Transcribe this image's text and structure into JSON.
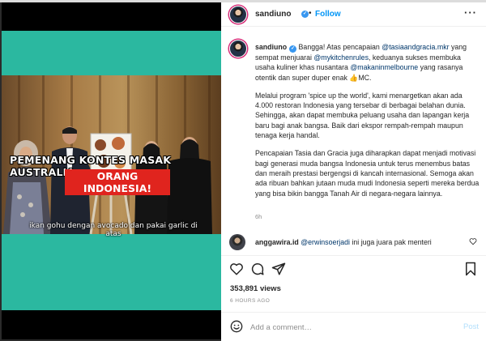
{
  "media": {
    "headline_line1": "PEMENANG KONTES MASAK AUSTRALIA,",
    "headline_line2": "ORANG INDONESIA!",
    "subtitle": "ikan gohu dengan avocado dan pakai garlic di atas",
    "teal_color": "#2bb8a0",
    "headline_bg_color": "#e0241e"
  },
  "header": {
    "username": "sandiuno",
    "verified_icon": "verified-badge-icon",
    "separator": "•",
    "follow_label": "Follow",
    "more_icon": "more-options-icon",
    "more_glyph": "···"
  },
  "caption": {
    "username": "sandiuno",
    "p1_part1": " Bangga! Atas pencapaian ",
    "mention1": "@tasiaandgracia.mkr",
    "p1_part2": " yang sempat menjuarai ",
    "mention2": "@mykitchenrules",
    "p1_part3": ", keduanya sukses membuka usaha kuliner khas nusantara ",
    "mention3": "@makaninmelbourne",
    "p1_part4": " yang rasanya otentik dan super duper enak 👍MC.",
    "p2": "Melalui program 'spice up the world', kami menargetkan akan ada 4.000 restoran Indonesia yang tersebar di berbagai belahan dunia. Sehingga, akan dapat membuka peluang usaha dan lapangan kerja baru bagi anak bangsa. Baik dari ekspor rempah-rempah maupun tenaga kerja handal.",
    "p3": "Pencapaian Tasia dan Gracia juga diharapkan dapat menjadi motivasi bagi generasi muda bangsa Indonesia untuk terus menembus batas dan meraih prestasi bergengsi di kancah internasional. Semoga akan ada ribuan bahkan jutaan muda mudi Indonesia seperti mereka berdua yang bisa bikin bangga Tanah Air di negara-negara lainnya.",
    "time": "6h"
  },
  "comment": {
    "username": "anggawira.id",
    "mention": "@erwinsoerjadi",
    "text": " ini juga juara pak menteri"
  },
  "actions": {
    "like_icon": "heart-icon",
    "comment_icon": "comment-bubble-icon",
    "share_icon": "paper-plane-icon",
    "save_icon": "bookmark-icon"
  },
  "stats": {
    "views": "353,891 views",
    "time_ago": "6 HOURS AGO"
  },
  "add_comment": {
    "emoji_icon": "smiley-icon",
    "placeholder": "Add a comment…",
    "post_label": "Post",
    "post_color": "#b2dffc"
  },
  "colors": {
    "link": "#00376b",
    "accent_blue": "#0095f6",
    "muted": "#8e8e8e"
  }
}
